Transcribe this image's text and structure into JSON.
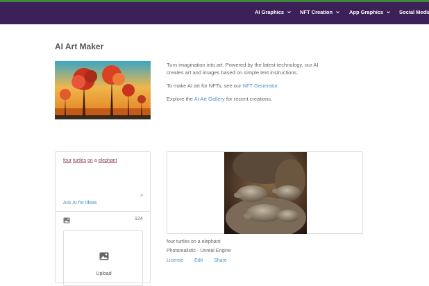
{
  "nav": {
    "items": [
      {
        "label": "AI Graphics"
      },
      {
        "label": "NFT Creation"
      },
      {
        "label": "App Graphics"
      },
      {
        "label": "Social Media G"
      }
    ]
  },
  "page": {
    "title": "AI Art Maker"
  },
  "intro": {
    "line1": "Turn imagination into art. Powered by the latest technology, our AI creates art and images based on simple text instructions.",
    "line2_prefix": "To make AI art for NFTs, see our ",
    "line2_link": "NFT Generator",
    "line2_suffix": ".",
    "line3_prefix": "Explore the ",
    "line3_link": "AI Art Gallery",
    "line3_suffix": " for recent creations."
  },
  "prompt": {
    "w1": "four",
    "w2": "turtles",
    "w3": "on",
    "w4": "a",
    "w5": "elephant",
    "ask_ai": "Ask AI for ideas",
    "count": "124",
    "upload_label": "Upload"
  },
  "result": {
    "caption": "four turtles on a elephant",
    "style": "Photorealistic - Unreal Engine",
    "actions": {
      "license": "License",
      "edit": "Edit",
      "share": "Share"
    }
  },
  "colors": {
    "nav_bg": "#3b2157",
    "accent_line": "#3f8a3a",
    "link": "#4a90c8"
  }
}
